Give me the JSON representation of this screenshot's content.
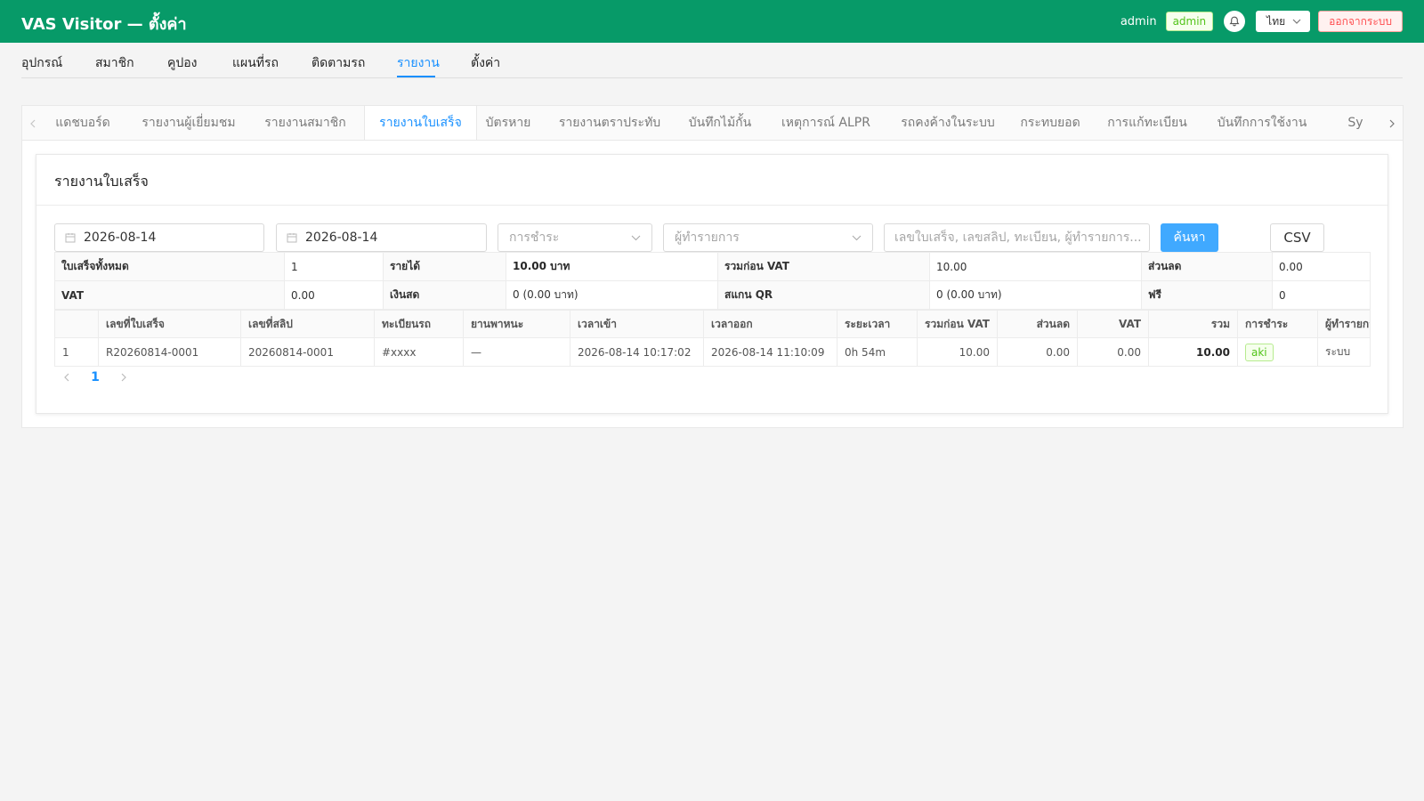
{
  "header": {
    "title": "VAS Visitor — ตั้งค่า",
    "user": "admin",
    "role": "admin",
    "language": "ไทย",
    "logout": "ออกจากระบบ"
  },
  "nav": {
    "items": [
      {
        "label": "อุปกรณ์"
      },
      {
        "label": "สมาชิก"
      },
      {
        "label": "คูปอง"
      },
      {
        "label": "แผนที่รถ"
      },
      {
        "label": "ติดตามรถ"
      },
      {
        "label": "รายงาน"
      },
      {
        "label": "ตั้งค่า"
      }
    ],
    "active": "รายงาน"
  },
  "tabs": {
    "items": [
      {
        "label": "แดชบอร์ด"
      },
      {
        "label": "รายงานผู้เยี่ยมชม"
      },
      {
        "label": "รายงานสมาชิก"
      },
      {
        "label": "รายงานใบเสร็จ"
      },
      {
        "label": "บัตรหาย"
      },
      {
        "label": "รายงานตราประทับ"
      },
      {
        "label": "บันทึกไม้กั้น"
      },
      {
        "label": "เหตุการณ์ ALPR"
      },
      {
        "label": "รถคงค้างในระบบ"
      },
      {
        "label": "กระทบยอด"
      },
      {
        "label": "การแก้ทะเบียน"
      },
      {
        "label": "บันทึกการใช้งาน"
      },
      {
        "label": "Sy"
      }
    ],
    "active": "รายงานใบเสร็จ"
  },
  "report": {
    "title": "รายงานใบเสร็จ",
    "filters": {
      "date_from": "2026-08-14",
      "date_to": "2026-08-14",
      "payment_placeholder": "การชำระ",
      "operator_placeholder": "ผู้ทำรายการ",
      "search_placeholder": "เลขใบเสร็จ, เลขสลิป, ทะเบียน, ผู้ทำรายการ...",
      "search_button": "ค้นหา",
      "csv_button": "CSV"
    },
    "summary": {
      "row1": [
        {
          "label": "ใบเสร็จทั้งหมด",
          "value": "1"
        },
        {
          "label": "รายได้",
          "value": "10.00 บาท"
        },
        {
          "label": "รวมก่อน VAT",
          "value": "10.00"
        },
        {
          "label": "ส่วนลด",
          "value": "0.00"
        }
      ],
      "row2": [
        {
          "label": "VAT",
          "value": "0.00"
        },
        {
          "label": "เงินสด",
          "value": "0 (0.00 บาท)"
        },
        {
          "label": "สแกน QR",
          "value": "0 (0.00 บาท)"
        },
        {
          "label": "ฟรี",
          "value": "0"
        }
      ]
    },
    "table": {
      "columns": [
        "",
        "เลขที่ใบเสร็จ",
        "เลขที่สลิป",
        "ทะเบียนรถ",
        "ยานพาหนะ",
        "เวลาเข้า",
        "เวลาออก",
        "ระยะเวลา",
        "รวมก่อน VAT",
        "ส่วนลด",
        "VAT",
        "รวม",
        "การชำระ",
        "ผู้ทำรายการ"
      ],
      "rows": [
        [
          "1",
          "R20260814-0001",
          "20260814-0001",
          "#xxxx",
          "—",
          "2026-08-14 10:17:02",
          "2026-08-14 11:10:09",
          "0h 54m",
          "10.00",
          "0.00",
          "0.00",
          "10.00",
          "aki",
          "ระบบ"
        ]
      ]
    },
    "pagination": {
      "current": "1"
    }
  },
  "colors": {
    "header_bg": "#079a68",
    "accent": "#1890ff",
    "success": "#52c41a",
    "danger": "#ff4d4f"
  }
}
